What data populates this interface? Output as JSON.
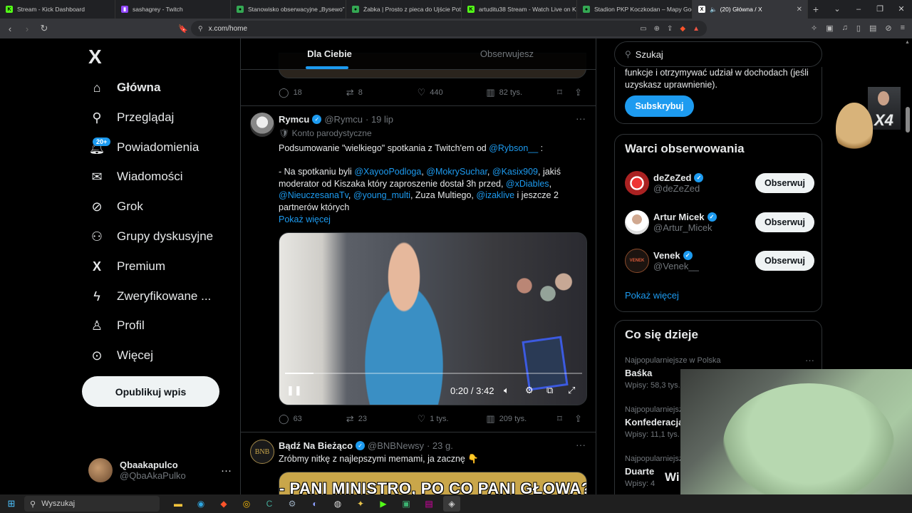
{
  "browser": {
    "tabs": [
      {
        "label": "Stream - Kick Dashboard",
        "color": "#53fc18",
        "glyph": "K"
      },
      {
        "label": "sashagrey - Twitch",
        "color": "#9146ff",
        "glyph": "▮"
      },
      {
        "label": "Stanowisko obserwacyjne „Bysewo”",
        "color": "#34a853",
        "glyph": "●"
      },
      {
        "label": "Żabka | Prosto z pieca do Ujście Pot...",
        "color": "#34a853",
        "glyph": "●"
      },
      {
        "label": "artuditu38 Stream - Watch Live on K...",
        "color": "#53fc18",
        "glyph": "K"
      },
      {
        "label": "Stadion PKP Koczkodan – Mapy Goo...",
        "color": "#34a853",
        "glyph": "●"
      },
      {
        "label": "(20) Główna / X",
        "color": "#ffffff",
        "glyph": "X"
      }
    ],
    "url": "x.com/home",
    "new_tab": "+",
    "window_controls": [
      "⌄",
      "–",
      "❐",
      "✕"
    ]
  },
  "nav": {
    "logo": "X",
    "items": [
      {
        "label": "Główna",
        "icon": "home-icon"
      },
      {
        "label": "Przeglądaj",
        "icon": "search-icon"
      },
      {
        "label": "Powiadomienia",
        "icon": "bell-icon"
      },
      {
        "label": "Wiadomości",
        "icon": "mail-icon"
      },
      {
        "label": "Grok",
        "icon": "grok-icon"
      },
      {
        "label": "Grupy dyskusyjne",
        "icon": "communities-icon"
      },
      {
        "label": "Premium",
        "icon": "x-premium-icon"
      },
      {
        "label": "Zweryfikowane ...",
        "icon": "lightning-icon"
      },
      {
        "label": "Profil",
        "icon": "person-icon"
      },
      {
        "label": "Więcej",
        "icon": "more-circle-icon"
      }
    ],
    "notifications_badge": "20+",
    "post_button": "Opublikuj wpis",
    "profile": {
      "name": "Qbaakapulco",
      "handle": "@QbaAkaPulko",
      "more": "···"
    }
  },
  "timeline": {
    "tabs": [
      "Dla Ciebie",
      "Obserwujesz"
    ],
    "prev_tweet_actions": {
      "replies": "18",
      "reposts": "8",
      "likes": "440",
      "views": "82 tys."
    },
    "tweet1": {
      "name": "Rymcu",
      "handle": "@Rymcu",
      "date": "· 19 lip",
      "parody": "Konto parodystyczne",
      "line1_a": "Podsumowanie \"wielkiego\" spotkania z Twitch'em od ",
      "line1_mention": "@Rybson__",
      "line1_b": " :",
      "p2_a": "- Na spotkaniu byli ",
      "m1": "@XayooPodloga",
      "c1": ", ",
      "m2": "@MokrySuchar",
      "c2": ", ",
      "m3": "@Kasix909",
      "p2_b": ", jakiś moderator od Kiszaka który zaproszenie dostał 3h przed, ",
      "m4": "@xDiables",
      "c3": ", ",
      "m5": "@NieuczesanaTv",
      "c4": ", ",
      "m6": "@young_multi",
      "p2_c": ", Zuza Multiego, ",
      "m7": "@izaklive",
      "p2_d": " i jeszcze 2 partnerów których",
      "show_more": "Pokaż więcej",
      "video_time": "0:20 / 3:42",
      "video_progress": 0.095,
      "actions": {
        "replies": "63",
        "reposts": "23",
        "likes": "1 tys.",
        "views": "209 tys."
      }
    },
    "tweet2": {
      "name": "Bądź Na Bieżąco",
      "handle": "@BNBNewsy",
      "date": "· 23 g.",
      "avatar_text": "BNB",
      "text": "Zróbmy nitkę z najlepszymi memami, ja zacznę 👇",
      "image_caption": "- PANI MINISTRO, PO CO PANI GŁOWA?"
    }
  },
  "right": {
    "search_placeholder": "Szukaj",
    "premium_text": "funkcje i otrzymywać udział w dochodach (jeśli uzyskasz uprawnienie).",
    "subscribe": "Subskrybuj",
    "follow_title": "Warci obserwowania",
    "follow": [
      {
        "name": "deZeZed",
        "handle": "@deZeZed",
        "button": "Obserwuj"
      },
      {
        "name": "Artur Micek",
        "handle": "@Artur_Micek",
        "button": "Obserwuj"
      },
      {
        "name": "Venek",
        "handle": "@Venek__",
        "button": "Obserwuj",
        "avatar_text": "VENEK"
      }
    ],
    "show_more": "Pokaż więcej",
    "trends_title": "Co się dzieje",
    "trends": [
      {
        "context": "Najpopularniejsze w Polska",
        "name": "Baśka",
        "posts": "Wpisy: 58,3 tys."
      },
      {
        "context": "Najpopularniejsze",
        "name": "Konfederacja",
        "posts": "Wpisy: 11,1 tys."
      },
      {
        "context": "Najpopularniejsze",
        "name": "Duarte",
        "posts": "Wpisy: 4"
      }
    ]
  },
  "overlay": {
    "x4": "X4",
    "webcam_text": "Wi"
  },
  "taskbar": {
    "search": "Wyszukaj"
  }
}
